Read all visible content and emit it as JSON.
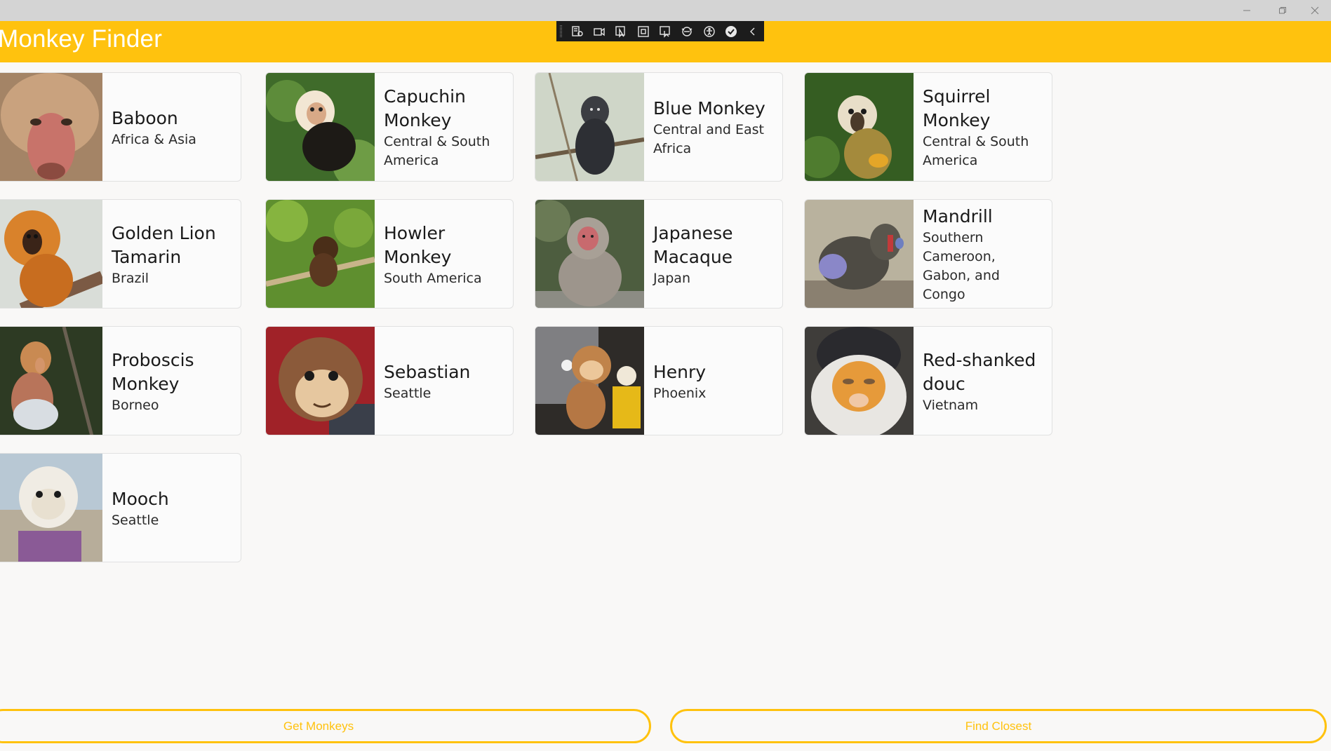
{
  "app": {
    "title": "Monkey Finder"
  },
  "window": {
    "buttons": [
      "minimize-icon",
      "maximize-icon",
      "close-icon"
    ]
  },
  "toolbar": {
    "icons": [
      "live-visual-tree-icon",
      "video-icon",
      "select-element-icon",
      "display-layout-adorners-icon",
      "track-focus-icon",
      "binding-failures-icon",
      "accessibility-icon",
      "hot-reload-ok-icon",
      "collapse-chevron-icon"
    ]
  },
  "colors": {
    "accent": "#ffc20e",
    "background": "#f9f8f7",
    "title_text": "#ffffff"
  },
  "monkeys": [
    {
      "name": "Baboon",
      "location": "Africa & Asia"
    },
    {
      "name": "Capuchin Monkey",
      "location": "Central & South America"
    },
    {
      "name": "Blue Monkey",
      "location": "Central and East Africa"
    },
    {
      "name": "Squirrel Monkey",
      "location": "Central & South America"
    },
    {
      "name": "Golden Lion Tamarin",
      "location": "Brazil"
    },
    {
      "name": "Howler Monkey",
      "location": "South America"
    },
    {
      "name": "Japanese Macaque",
      "location": "Japan"
    },
    {
      "name": "Mandrill",
      "location": "Southern Cameroon, Gabon, and Congo"
    },
    {
      "name": "Proboscis Monkey",
      "location": "Borneo"
    },
    {
      "name": "Sebastian",
      "location": "Seattle"
    },
    {
      "name": "Henry",
      "location": "Phoenix"
    },
    {
      "name": "Red-shanked douc",
      "location": "Vietnam"
    },
    {
      "name": "Mooch",
      "location": "Seattle"
    }
  ],
  "actions": {
    "get_monkeys": "Get Monkeys",
    "find_closest": "Find Closest"
  }
}
